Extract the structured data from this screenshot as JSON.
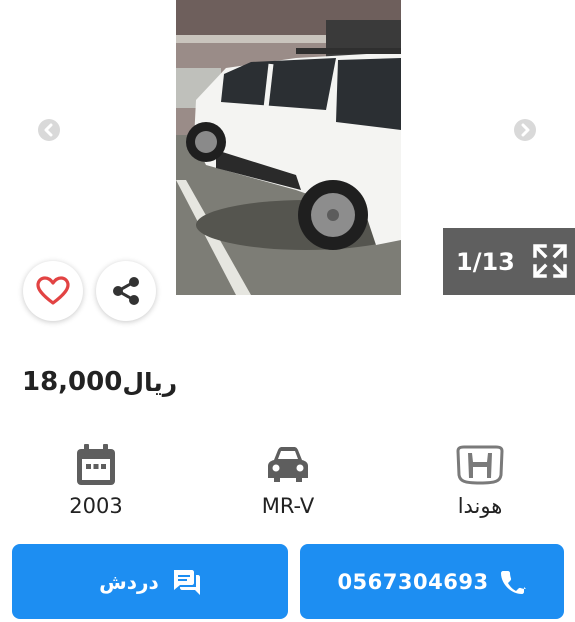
{
  "gallery": {
    "counter": "1/13",
    "photo_alt": "",
    "icons": {
      "prev": "chevron-left-icon",
      "next": "chevron-right-icon",
      "fullscreen": "fullscreen-icon",
      "favorite": "heart-icon",
      "share": "share-icon"
    }
  },
  "listing": {
    "price": "18,000",
    "currency": "ريال"
  },
  "specs": {
    "year": {
      "icon": "calendar-icon",
      "value": "2003"
    },
    "model": {
      "icon": "car-icon",
      "value": "MR-V"
    },
    "make": {
      "icon": "honda-logo-icon",
      "value": "هوندا"
    }
  },
  "actions": {
    "chat_label": "دردش",
    "chat_icon": "chat-icon",
    "phone": "0567304693",
    "phone_icon": "phone-icon"
  },
  "colors": {
    "primary": "#1d8ef2",
    "counter_bg": "#5f5f5f",
    "heart": "#e24343"
  }
}
